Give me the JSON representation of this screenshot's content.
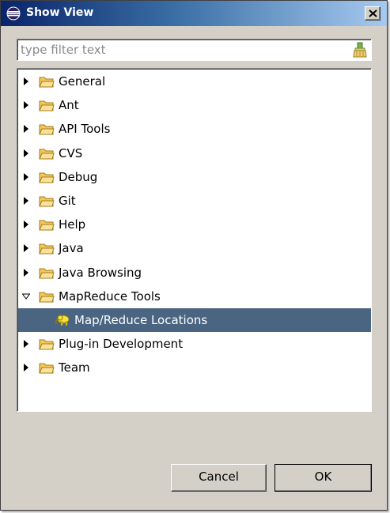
{
  "window": {
    "title": "Show View",
    "icon": "eclipse-icon",
    "close_icon": "close-icon"
  },
  "filter": {
    "value": "",
    "placeholder": "type filter text",
    "clear_icon": "clear-filter-icon"
  },
  "tree": {
    "items": [
      {
        "label": "General",
        "expanded": false
      },
      {
        "label": "Ant",
        "expanded": false
      },
      {
        "label": "API Tools",
        "expanded": false
      },
      {
        "label": "CVS",
        "expanded": false
      },
      {
        "label": "Debug",
        "expanded": false
      },
      {
        "label": "Git",
        "expanded": false
      },
      {
        "label": "Help",
        "expanded": false
      },
      {
        "label": "Java",
        "expanded": false
      },
      {
        "label": "Java Browsing",
        "expanded": false
      },
      {
        "label": "MapReduce Tools",
        "expanded": true
      },
      {
        "label": "Map/Reduce Locations",
        "child": true,
        "selected": true,
        "icon": "elephant-icon"
      },
      {
        "label": "Plug-in Development",
        "expanded": false
      },
      {
        "label": "Team",
        "expanded": false
      }
    ]
  },
  "buttons": {
    "cancel_label": "Cancel",
    "ok_label": "OK"
  },
  "colors": {
    "selection": "#4a6582",
    "dialog_bg": "#d4d0c8",
    "folder": "#f3c75a"
  }
}
